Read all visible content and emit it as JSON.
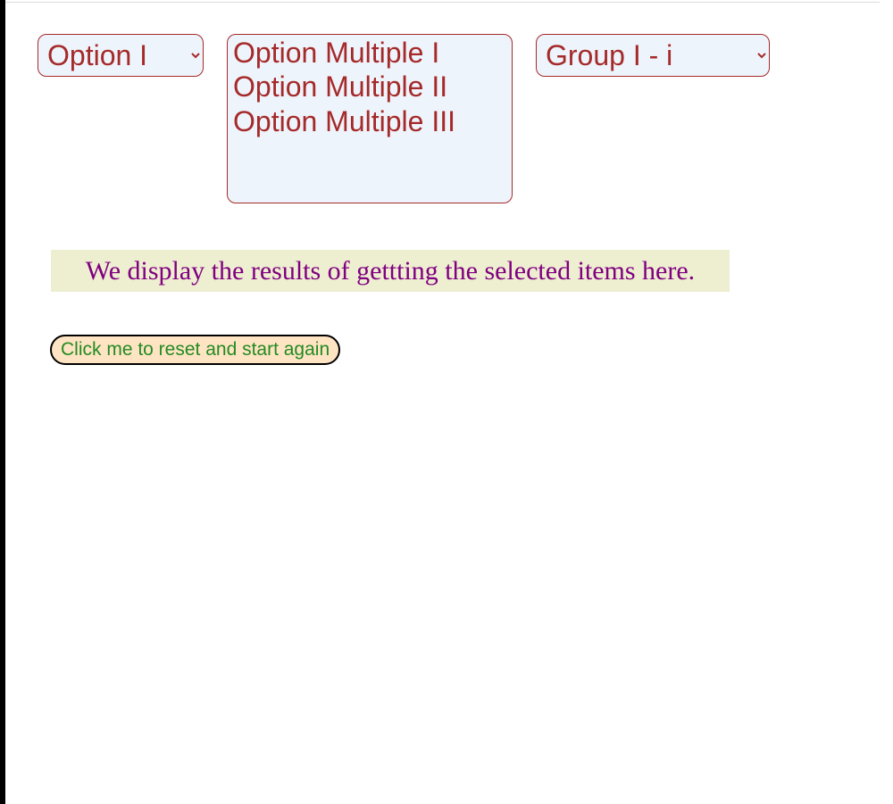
{
  "selects": {
    "single": {
      "selected": "Option I",
      "options": [
        "Option I"
      ]
    },
    "multiple": {
      "options": [
        "Option Multiple I",
        "Option Multiple II",
        "Option Multiple III"
      ]
    },
    "group": {
      "selected": "Group I - i",
      "options": [
        "Group I - i"
      ]
    }
  },
  "result_text": "We display the results of gettting the selected items here.",
  "reset_button_label": "Click me to reset and start again"
}
